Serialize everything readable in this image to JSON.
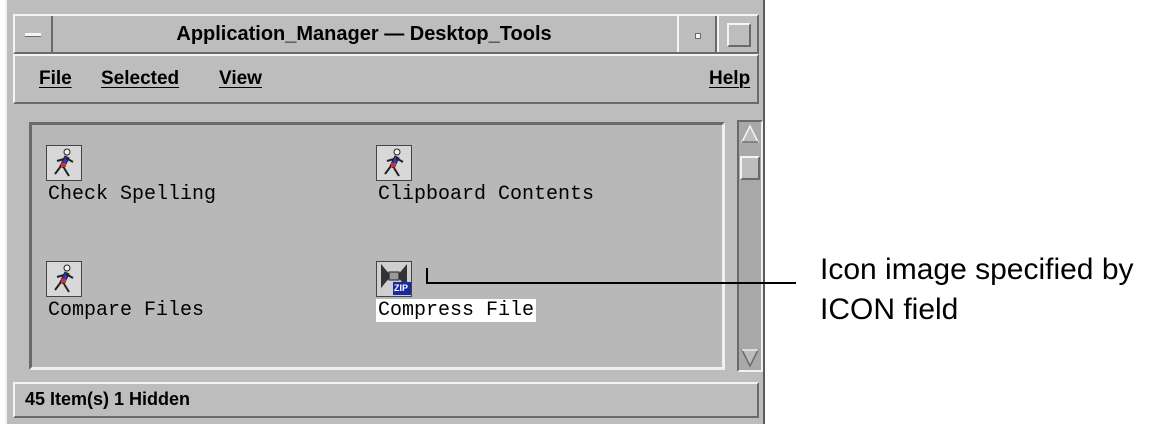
{
  "window": {
    "title": "Application_Manager — Desktop_Tools"
  },
  "menu": {
    "file": "File",
    "selected": "Selected",
    "view": "View",
    "help": "Help"
  },
  "items": [
    {
      "label": "Check Spelling",
      "icon": "runner-icon"
    },
    {
      "label": "Clipboard Contents",
      "icon": "runner-icon"
    },
    {
      "label": "Compare Files",
      "icon": "runner-icon"
    },
    {
      "label": "Compress File",
      "icon": "zip-icon",
      "icon_text": "ZIP"
    }
  ],
  "status": "45 Item(s) 1 Hidden",
  "callout": {
    "line1": "Icon image specified by",
    "line2": "ICON field"
  }
}
